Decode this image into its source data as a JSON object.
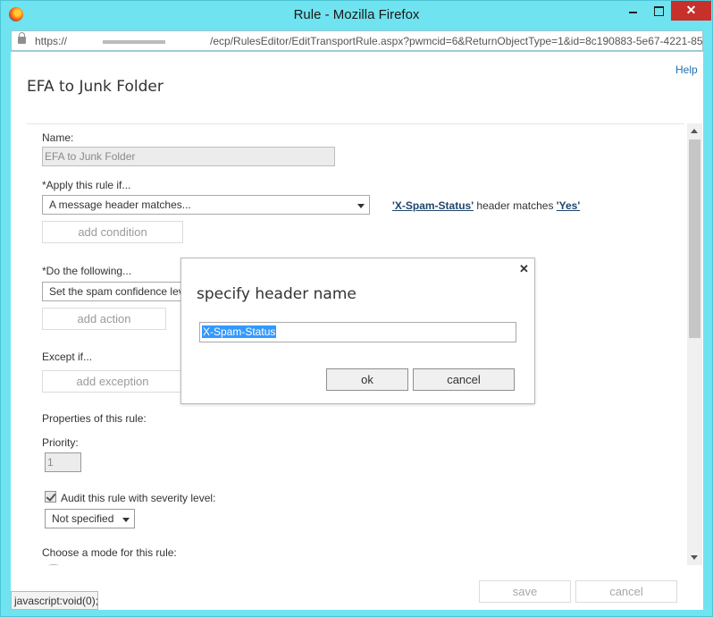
{
  "window": {
    "title": "Rule - Mozilla Firefox",
    "close_glyph": "✕"
  },
  "address_bar": {
    "url_prefix": "https://",
    "url_suffix": "/ecp/RulesEditor/EditTransportRule.aspx?pwmcid=6&ReturnObjectType=1&id=8c190883-5e67-4221-853"
  },
  "page": {
    "help_label": "Help",
    "title": "EFA to Junk Folder"
  },
  "form": {
    "name_label": "Name:",
    "name_value": "EFA to Junk Folder",
    "apply_label": "*Apply this rule if...",
    "apply_value": "A message header matches...",
    "condition": {
      "header_name": "'X-Spam-Status'",
      "middle_text": " header matches ",
      "header_value": "'Yes'"
    },
    "add_condition_label": "add condition",
    "do_label": "*Do the following...",
    "do_value": "Set the spam confidence lev",
    "add_action_label": "add action",
    "except_label": "Except if...",
    "add_exception_label": "add exception",
    "properties_label": "Properties of this rule:",
    "priority_label": "Priority:",
    "priority_value": "1",
    "audit_label": "Audit this rule with severity level:",
    "severity_value": "Not specified",
    "mode_label": "Choose a mode for this rule:"
  },
  "footer": {
    "save_label": "save",
    "cancel_label": "cancel"
  },
  "status_bar": {
    "text": "javascript:void(0);"
  },
  "dialog": {
    "title": "specify header name",
    "close_glyph": "✕",
    "input_value": "X-Spam-Status",
    "ok_label": "ok",
    "cancel_label": "cancel"
  }
}
